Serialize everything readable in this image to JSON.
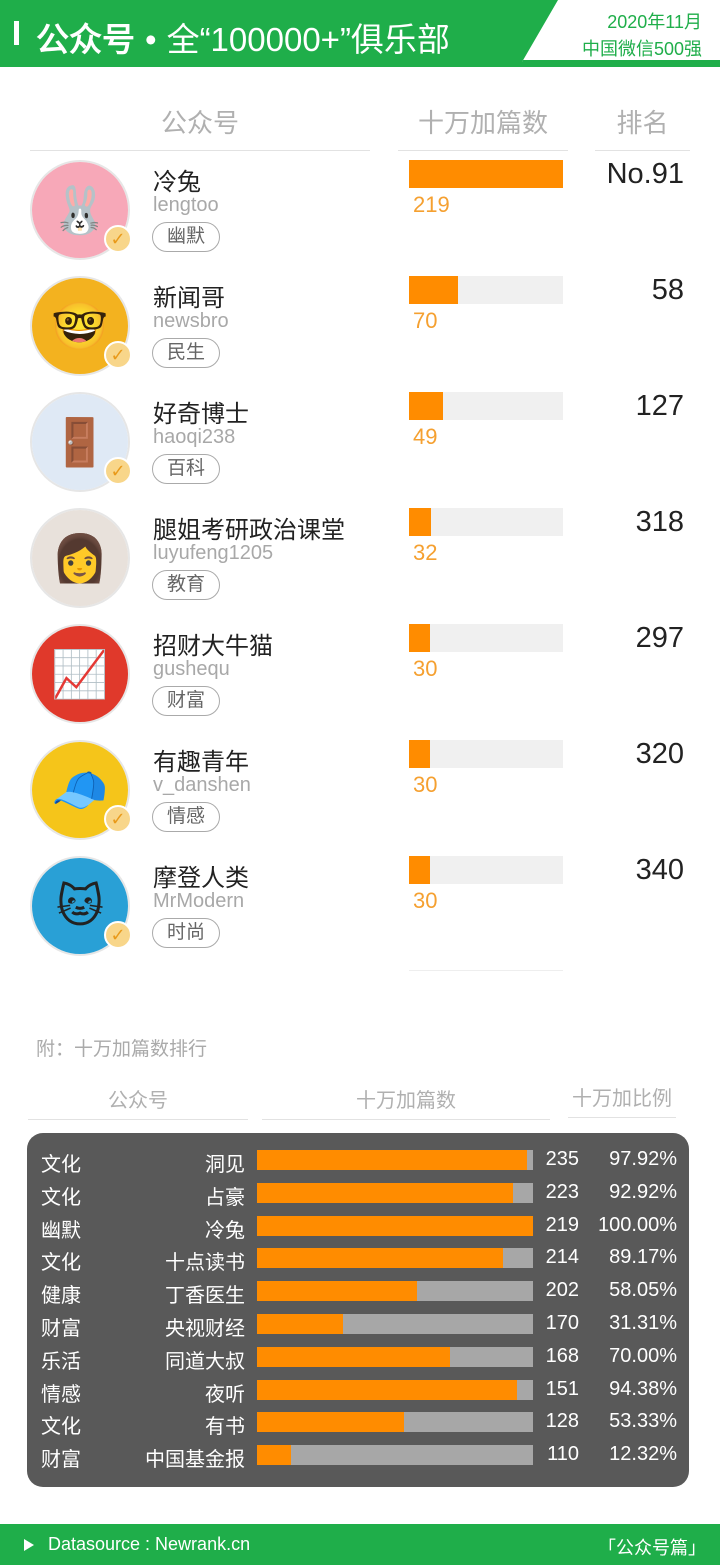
{
  "header": {
    "title_strong": "公众号",
    "dot": "•",
    "title_rest": "全“100000+”俱乐部",
    "badge_line1": "2020年11月",
    "badge_line2": "中国微信500强"
  },
  "columns": {
    "account": "公众号",
    "count": "十万加篇数",
    "rank": "排名"
  },
  "accounts": [
    {
      "name": "冷兔",
      "handle": "lengtoo",
      "tag": "幽默",
      "count": 219,
      "count_label": "219",
      "rank": "No.91",
      "verified": true,
      "fill_ratio": 1.0,
      "avatar_color": "#f7a8b8",
      "avatar_glyph": "🐰"
    },
    {
      "name": "新闻哥",
      "handle": "newsbro",
      "tag": "民生",
      "count": 70,
      "count_label": "70",
      "rank": "58",
      "verified": true,
      "fill_ratio": 0.3196,
      "avatar_color": "#f3b21f",
      "avatar_glyph": "🤓"
    },
    {
      "name": "好奇博士",
      "handle": "haoqi238",
      "tag": "百科",
      "count": 49,
      "count_label": "49",
      "rank": "127",
      "verified": true,
      "fill_ratio": 0.2237,
      "avatar_color": "#dfe9f5",
      "avatar_glyph": "🚪"
    },
    {
      "name": "腿姐考研政治课堂",
      "handle": "luyufeng1205",
      "tag": "教育",
      "count": 32,
      "count_label": "32",
      "rank": "318",
      "verified": false,
      "fill_ratio": 0.1461,
      "avatar_color": "#e8e1db",
      "avatar_glyph": "👩"
    },
    {
      "name": "招财大牛猫",
      "handle": "gushequ",
      "tag": "财富",
      "count": 30,
      "count_label": "30",
      "rank": "297",
      "verified": false,
      "fill_ratio": 0.137,
      "avatar_color": "#e0392b",
      "avatar_glyph": "📈"
    },
    {
      "name": "有趣青年",
      "handle": "v_danshen",
      "tag": "情感",
      "count": 30,
      "count_label": "30",
      "rank": "320",
      "verified": true,
      "fill_ratio": 0.137,
      "avatar_color": "#f5c51a",
      "avatar_glyph": "🧢"
    },
    {
      "name": "摩登人类",
      "handle": "MrModern",
      "tag": "时尚",
      "count": 30,
      "count_label": "30",
      "rank": "340",
      "verified": true,
      "fill_ratio": 0.137,
      "avatar_color": "#29a0d6",
      "avatar_glyph": "🐱"
    }
  ],
  "appendix": {
    "note": "附：十万加篇数排行",
    "col_account": "公众号",
    "col_count": "十万加篇数",
    "col_ratio": "十万加比例",
    "rows": [
      {
        "cat": "文化",
        "name": "洞见",
        "value": "235",
        "pct": "97.92%",
        "ratio": 0.9792
      },
      {
        "cat": "文化",
        "name": "占豪",
        "value": "223",
        "pct": "92.92%",
        "ratio": 0.9292
      },
      {
        "cat": "幽默",
        "name": "冷兔",
        "value": "219",
        "pct": "100.00%",
        "ratio": 1.0
      },
      {
        "cat": "文化",
        "name": "十点读书",
        "value": "214",
        "pct": "89.17%",
        "ratio": 0.8917
      },
      {
        "cat": "健康",
        "name": "丁香医生",
        "value": "202",
        "pct": "58.05%",
        "ratio": 0.5805
      },
      {
        "cat": "财富",
        "name": "央视财经",
        "value": "170",
        "pct": "31.31%",
        "ratio": 0.3131
      },
      {
        "cat": "乐活",
        "name": "同道大叔",
        "value": "168",
        "pct": "70.00%",
        "ratio": 0.7
      },
      {
        "cat": "情感",
        "name": "夜听",
        "value": "151",
        "pct": "94.38%",
        "ratio": 0.9438
      },
      {
        "cat": "文化",
        "name": "有书",
        "value": "128",
        "pct": "53.33%",
        "ratio": 0.5333
      },
      {
        "cat": "财富",
        "name": "中国基金报",
        "value": "110",
        "pct": "12.32%",
        "ratio": 0.1232
      }
    ]
  },
  "footer": {
    "source": "Datasource : Newrank.cn",
    "label": "「公众号篇」"
  },
  "colors": {
    "brand_green": "#1fae4a",
    "bar_orange": "#ff8c00",
    "panel_gray": "#595959"
  }
}
